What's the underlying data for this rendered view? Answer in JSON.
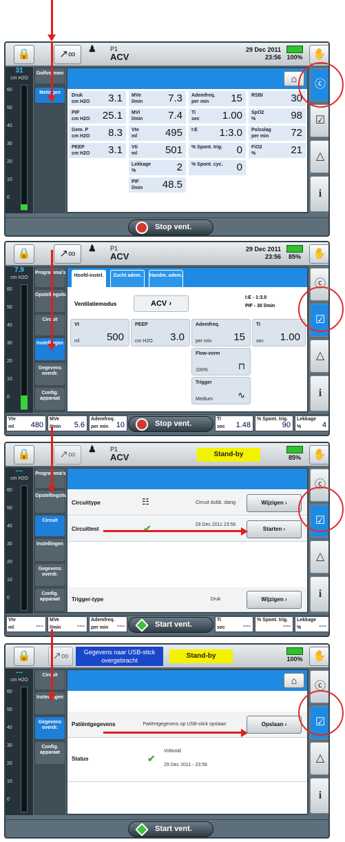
{
  "screen1": {
    "patient": "P1",
    "mode": "ACV",
    "datetime": {
      "date": "29 Dec 2011",
      "time": "23:56"
    },
    "battery": "100%",
    "gauge": {
      "value": "31",
      "unit": "cm H2O",
      "ticks": [
        "60",
        "50",
        "40",
        "30",
        "20",
        "10",
        "0"
      ]
    },
    "tabs": [
      "Golfvormen",
      "Metingen"
    ],
    "measurements": [
      {
        "label": "Druk",
        "unit": "cm H2O",
        "value": "3.1"
      },
      {
        "label": "PIP",
        "unit": "cm H2O",
        "value": "25.1"
      },
      {
        "label": "Gem. P",
        "unit": "cm H2O",
        "value": "8.3"
      },
      {
        "label": "PEEP",
        "unit": "cm H2O",
        "value": "3.1"
      },
      {
        "label": "MVe",
        "unit": "l/min",
        "value": "7.3"
      },
      {
        "label": "MVi",
        "unit": "l/min",
        "value": "7.4"
      },
      {
        "label": "Vte",
        "unit": "ml",
        "value": "495"
      },
      {
        "label": "Vti",
        "unit": "ml",
        "value": "501"
      },
      {
        "label": "Lekkage",
        "unit": "%",
        "value": "2"
      },
      {
        "label": "PIF",
        "unit": "l/min",
        "value": "48.5"
      },
      {
        "label": "Ademfreq.",
        "unit": "per min",
        "value": "15"
      },
      {
        "label": "Ti",
        "unit": "sec",
        "value": "1.00"
      },
      {
        "label": "I:E",
        "unit": "",
        "value": "1:3.0"
      },
      {
        "label": "% Spont. trig.",
        "unit": "",
        "value": "0"
      },
      {
        "label": "% Spont. cyc.",
        "unit": "",
        "value": "0"
      },
      {
        "label": "RSBI",
        "unit": "",
        "value": "30"
      },
      {
        "label": "SpO2",
        "unit": "%",
        "value": "98"
      },
      {
        "label": "Polsslag",
        "unit": "per min",
        "value": "72"
      },
      {
        "label": "FiO2",
        "unit": "%",
        "value": "21"
      }
    ],
    "vent_button": "Stop vent."
  },
  "screen2": {
    "patient": "P1",
    "mode": "ACV",
    "datetime": {
      "date": "29 Dec 2011",
      "time": "23:56"
    },
    "battery": "85%",
    "gauge": {
      "value": "7.9",
      "unit": "cm H2O",
      "ticks": [
        "60",
        "50",
        "40",
        "30",
        "20",
        "10",
        "0"
      ]
    },
    "tabs": [
      "Programma's",
      "Opstellingshulp",
      "Circuit",
      "Instellingen",
      "Gegevens overdr.",
      "Config. apparaat"
    ],
    "subtabs": [
      "Hoofd-instel.",
      "Zucht adem.",
      "Handm. adem."
    ],
    "ventilatiemodus_label": "Ventilatiemodus",
    "ventilatiemodus_value": "ACV",
    "ie_info": "I:E - 1:3.0",
    "pif_info": "PIF - 30   l/min",
    "settings": [
      {
        "label": "Vt",
        "unit": "ml",
        "value": "500"
      },
      {
        "label": "PEEP",
        "unit": "cm H2O",
        "value": "3.0"
      },
      {
        "label": "Ademfreq.",
        "unit": "per min",
        "value": "15"
      },
      {
        "label": "Ti",
        "unit": "sec",
        "value": "1.00"
      }
    ],
    "flowvorm": {
      "label": "Flow-vorm",
      "value": "100%"
    },
    "trigger": {
      "label": "Trigger",
      "value": "Medium"
    },
    "bottom": [
      {
        "label": "Vte",
        "unit": "ml",
        "value": "480"
      },
      {
        "label": "MVe",
        "unit": "l/min",
        "value": "5.6"
      },
      {
        "label": "Ademfreq.",
        "unit": "per min",
        "value": "10"
      },
      {
        "label": "Ti",
        "unit": "sec",
        "value": "1.48"
      },
      {
        "label": "% Spont. trig.",
        "unit": "",
        "value": "90"
      },
      {
        "label": "Lekkage",
        "unit": "%",
        "value": "4"
      }
    ],
    "vent_button": "Stop vent."
  },
  "screen3": {
    "patient": "P1",
    "mode": "ACV",
    "status": "Stand-by",
    "battery": "85%",
    "gauge": {
      "value": "---",
      "unit": "cm H2O",
      "ticks": [
        "60",
        "50",
        "40",
        "30",
        "20",
        "10",
        "0"
      ]
    },
    "tabs": [
      "Programma's",
      "Opstellingshulp",
      "Circuit",
      "Instellingen",
      "Gegevens overdr.",
      "Config. apparaat"
    ],
    "rows": [
      {
        "label": "Circuittype",
        "value": "Circuit dubb. slang",
        "button": "Wijzigen"
      },
      {
        "label": "Circuittest",
        "value": "29 Dec 2011 23:56",
        "button": "Starten"
      },
      {
        "label": "Trigger-type",
        "value": "Druk",
        "button": "Wijzigen"
      }
    ],
    "bottom": [
      {
        "label": "Vte",
        "unit": "ml",
        "value": "---"
      },
      {
        "label": "MVe",
        "unit": "l/min",
        "value": "---"
      },
      {
        "label": "Ademfreq.",
        "unit": "per min",
        "value": "---"
      },
      {
        "label": "Ti",
        "unit": "sec",
        "value": "---"
      },
      {
        "label": "% Spont. trig.",
        "unit": "",
        "value": "---"
      },
      {
        "label": "Lekkage",
        "unit": "%",
        "value": "---"
      }
    ],
    "vent_button": "Start vent."
  },
  "screen4": {
    "usb_message": "Gegevens naar USB-stick overgebracht",
    "status": "Stand-by",
    "battery": "100%",
    "gauge": {
      "value": "---",
      "unit": "cm H2O",
      "ticks": [
        "60",
        "50",
        "40",
        "30",
        "20",
        "10",
        "0"
      ]
    },
    "tabs": [
      "Circuit",
      "Instellingen",
      "Gegevens overdr.",
      "Config. apparaat"
    ],
    "patient_label": "Patiëntgegevens",
    "patient_value": "Patiëntgegevens op USB-stick  opslaan",
    "save_button": "Opslaan",
    "status_label": "Status",
    "status_value": "Voltooid",
    "status_time": "29 Dec 2011 - 23:56",
    "vent_button": "Start vent."
  },
  "colors": {
    "accent": "#1f8ae3",
    "alert": "#e02b2b",
    "standby": "#f5f200",
    "ok": "#3cb33c"
  }
}
